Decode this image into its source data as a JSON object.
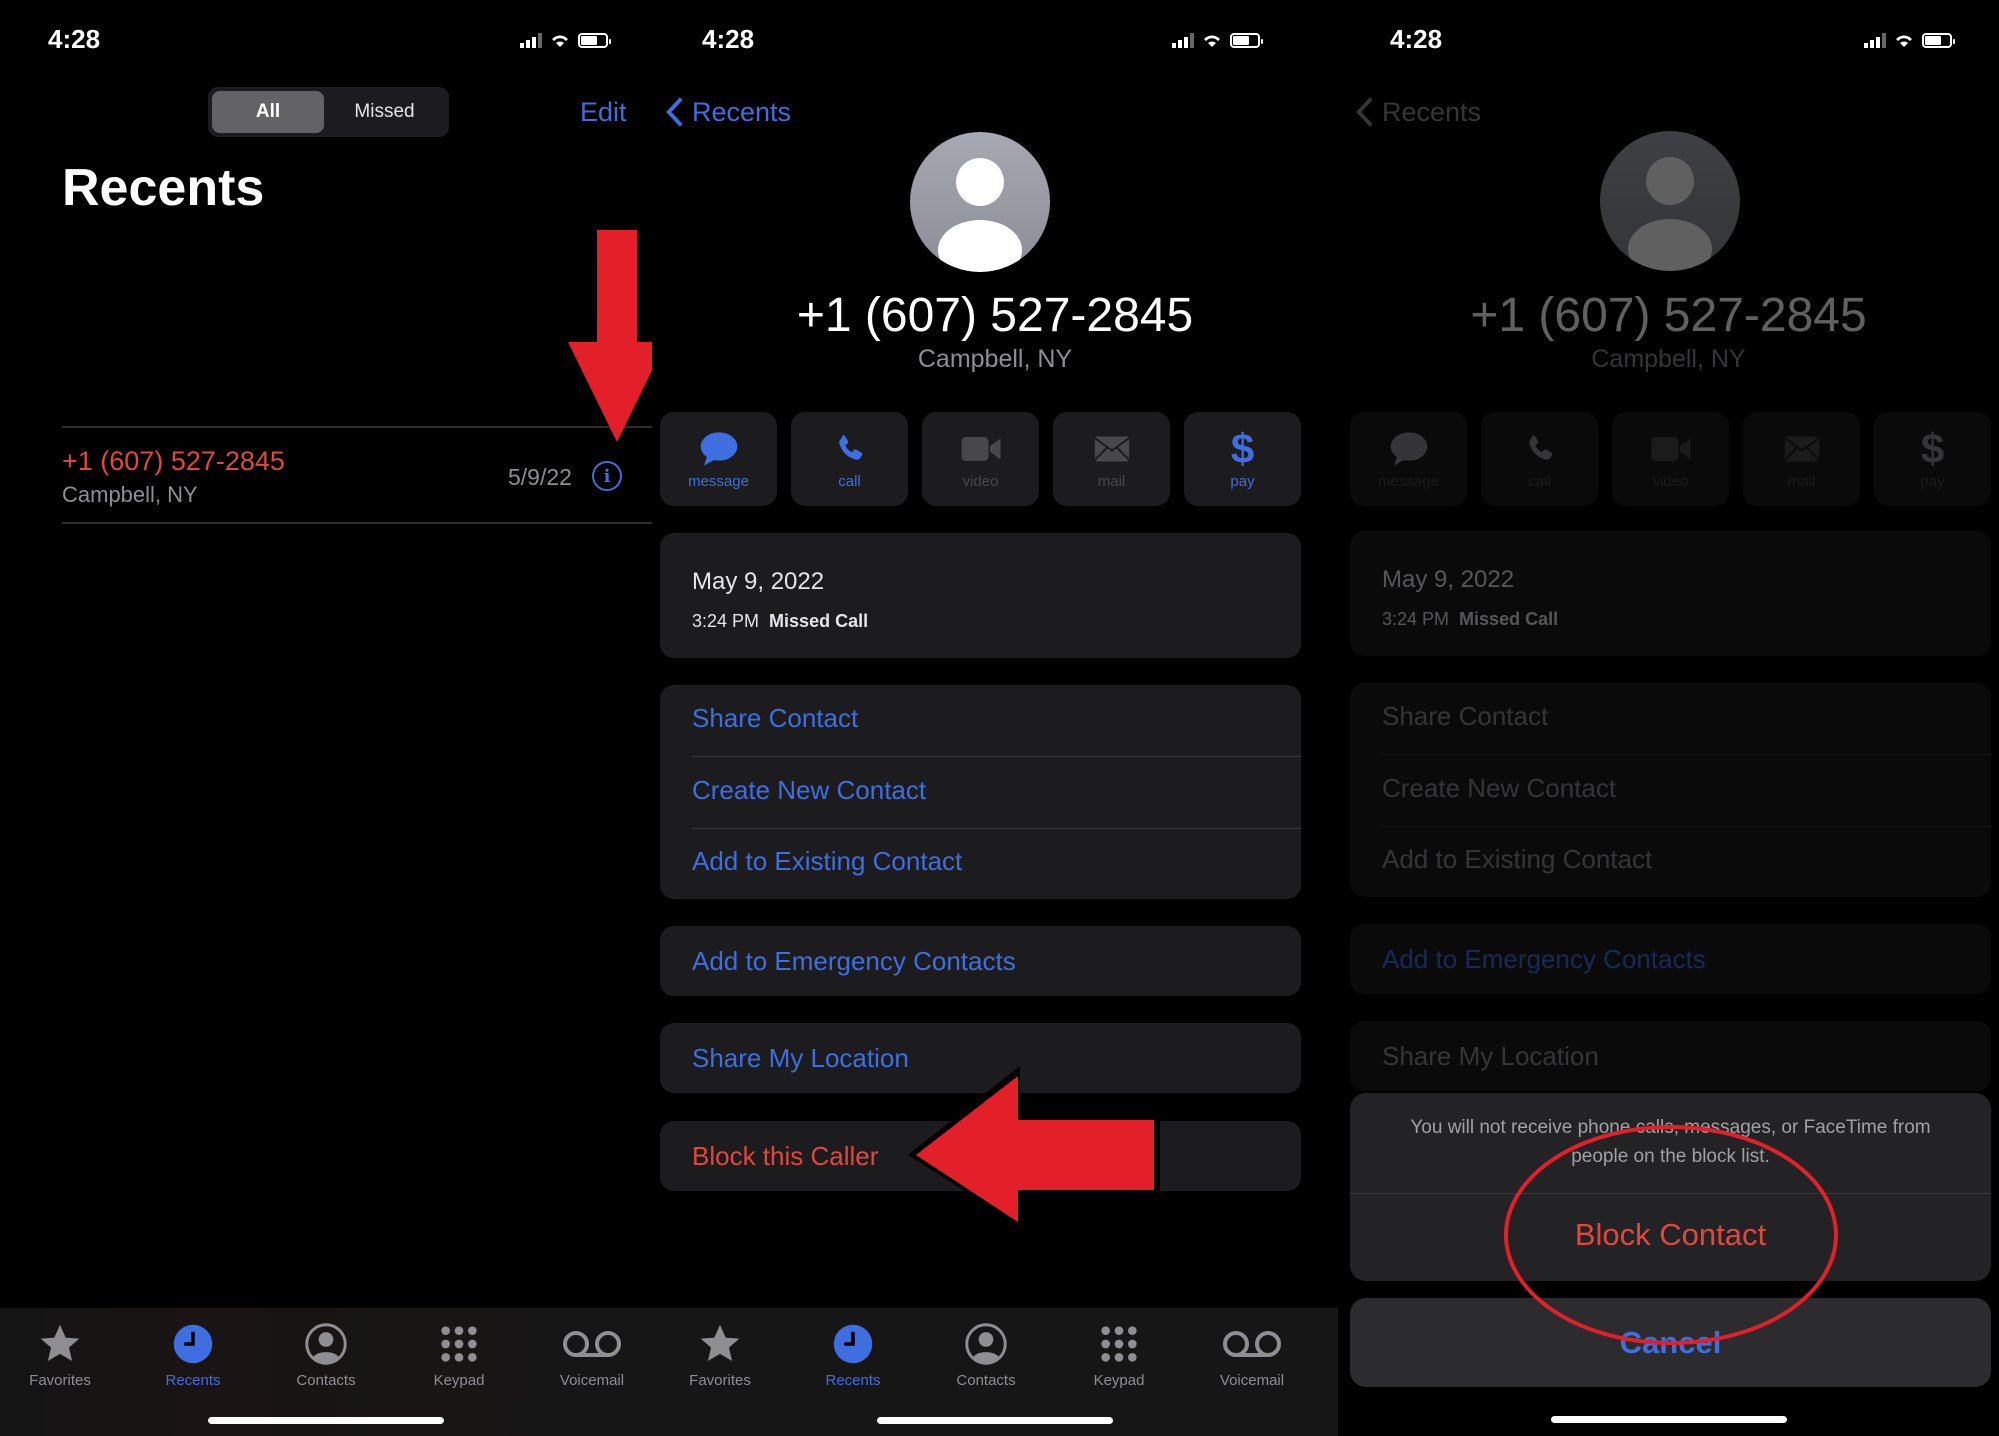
{
  "status_bar": {
    "time": "4:28"
  },
  "screen1": {
    "segment": {
      "all": "All",
      "missed": "Missed",
      "selected": "All"
    },
    "edit_label": "Edit",
    "title": "Recents",
    "calls": [
      {
        "number": "+1 (607) 527-2845",
        "location": "Campbell, NY",
        "date": "5/9/22",
        "missed": true
      }
    ]
  },
  "tabbar": {
    "items": [
      {
        "label": "Favorites",
        "icon": "star-icon"
      },
      {
        "label": "Recents",
        "icon": "clock-icon",
        "active": true
      },
      {
        "label": "Contacts",
        "icon": "person-circle-icon"
      },
      {
        "label": "Keypad",
        "icon": "keypad-icon"
      },
      {
        "label": "Voicemail",
        "icon": "voicemail-icon"
      }
    ]
  },
  "detail": {
    "back_label": "Recents",
    "number": "+1 (607) 527-2845",
    "location": "Campbell, NY",
    "actions": [
      {
        "label": "message",
        "enabled": true
      },
      {
        "label": "call",
        "enabled": true
      },
      {
        "label": "video",
        "enabled": false
      },
      {
        "label": "mail",
        "enabled": false
      },
      {
        "label": "pay",
        "enabled": true
      }
    ],
    "call_info": {
      "date": "May 9, 2022",
      "time": "3:24 PM",
      "type": "Missed Call"
    },
    "contact_options": [
      "Share Contact",
      "Create New Contact",
      "Add to Existing Contact"
    ],
    "emergency": "Add to Emergency Contacts",
    "share_location": "Share My Location",
    "block": "Block this Caller"
  },
  "block_sheet": {
    "message": "You will not receive phone calls, messages, or FaceTime from people on the block list.",
    "confirm": "Block Contact",
    "cancel": "Cancel"
  },
  "colors": {
    "accent": "#3e6ee0",
    "destructive": "#e0483d",
    "annotation": "#e3202a"
  }
}
